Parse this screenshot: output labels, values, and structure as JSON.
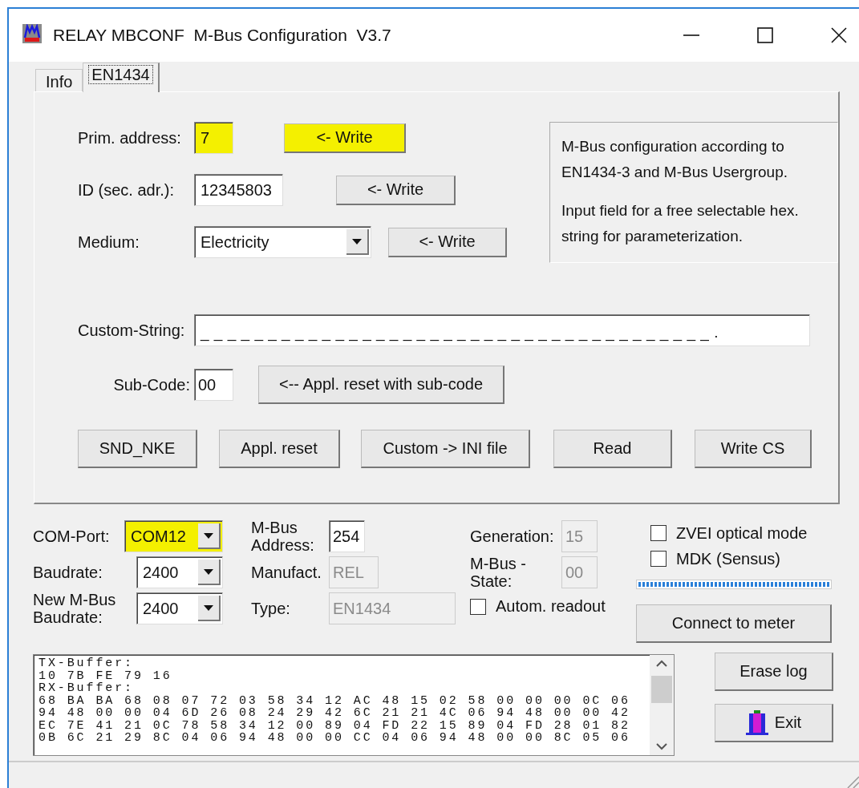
{
  "window": {
    "title": "RELAY MBCONF  M-Bus Configuration  V3.7"
  },
  "tabs": [
    {
      "label": "Info",
      "selected": false
    },
    {
      "label": "EN1434",
      "selected": true
    }
  ],
  "config": {
    "rows": [
      {
        "label": "Prim. address:",
        "kind": "text",
        "value": "7",
        "highlighted": true,
        "button": {
          "label": "<- Write",
          "highlighted": true
        }
      },
      {
        "label": "ID (sec. adr.):",
        "kind": "text",
        "value": "12345803",
        "highlighted": false,
        "button": {
          "label": "<- Write",
          "highlighted": false
        }
      },
      {
        "label": "Medium:",
        "kind": "combo",
        "value": "Electricity",
        "highlighted": false,
        "button": {
          "label": "<- Write",
          "highlighted": false
        }
      }
    ],
    "info": [
      "M-Bus configuration according to EN1434-3 and M-Bus Usergroup.",
      "Input field for a free selectable hex. string for parameterization."
    ],
    "custom_string": {
      "label": "Custom-String:",
      "value": "_ _ _ _ _ _ _ _ _ _ _ _ _ _ _ _ _ _ _ _ _ _ _ _ _ _ _ _ _ _ _ _ _ _ _ _ _ _ ."
    },
    "sub_code": {
      "label": "Sub-Code:",
      "value": "00",
      "button": "<-- Appl. reset with sub-code"
    },
    "actions": [
      "SND_NKE",
      "Appl. reset",
      "Custom -> INI file",
      "Read",
      "Write CS"
    ]
  },
  "connection": {
    "ports": [
      {
        "label": "COM-Port:",
        "value": "COM12",
        "highlighted": true
      },
      {
        "label": "Baudrate:",
        "value": "2400",
        "highlighted": false
      },
      {
        "label": "New M-Bus Baudrate:",
        "value": "2400",
        "highlighted": false
      }
    ],
    "meter": [
      {
        "label": "M-Bus Address:",
        "value": "254",
        "disabled": false
      },
      {
        "label": "Manufact.",
        "value": "REL",
        "disabled": true
      },
      {
        "label": "Type:",
        "value": "EN1434",
        "disabled": true
      }
    ],
    "status": [
      {
        "label": "Generation:",
        "value": "15",
        "disabled": true
      },
      {
        "label": "M-Bus - State:",
        "value": "00",
        "disabled": true
      }
    ],
    "autom_readout": {
      "label": "Autom. readout",
      "checked": false
    },
    "options": [
      {
        "label": "ZVEI optical mode",
        "checked": false
      },
      {
        "label": "MDK (Sensus)",
        "checked": false
      }
    ],
    "progress": {
      "level": 1
    },
    "connect_button": "Connect to meter"
  },
  "log": {
    "lines": [
      "TX-Buffer:",
      "10 7B FE 79 16",
      "RX-Buffer:",
      "68 BA BA 68 08 07 72 03 58 34 12 AC 48 15 02 58 00 00 00 0C 06",
      "94 48 00 00 04 6D 26 08 24 29 42 6C 21 21 4C 06 94 48 00 00 42",
      "EC 7E 41 21 0C 78 58 34 12 00 89 04 FD 22 15 89 04 FD 28 01 82",
      "0B 6C 21 29 8C 04 06 94 48 00 00 CC 04 06 94 48 00 00 8C 05 06"
    ]
  },
  "side_buttons": [
    {
      "label": "Erase log",
      "kind": "plain"
    },
    {
      "label": "Exit",
      "kind": "exit"
    }
  ]
}
